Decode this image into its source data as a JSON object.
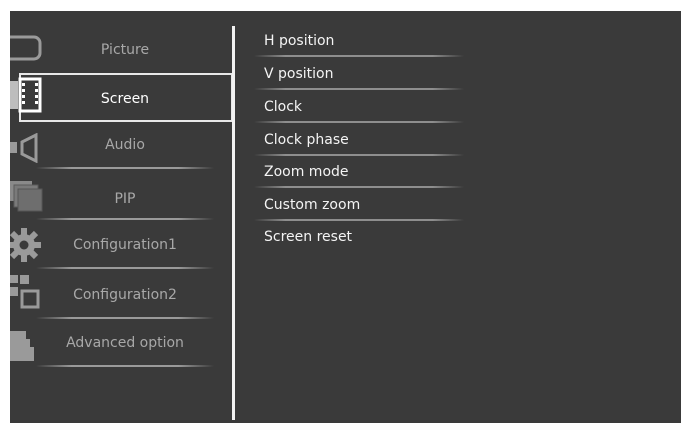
{
  "menu": {
    "items": [
      {
        "label": "Picture",
        "icon": "monitor-icon"
      },
      {
        "label": "Screen",
        "icon": "film-strip-icon"
      },
      {
        "label": "Audio",
        "icon": "speaker-icon"
      },
      {
        "label": "PIP",
        "icon": "stacked-screens-icon"
      },
      {
        "label": "Configuration1",
        "icon": "gear-icon"
      },
      {
        "label": "Configuration2",
        "icon": "grid-squares-icon"
      },
      {
        "label": "Advanced option",
        "icon": "staircase-icon"
      }
    ],
    "selected": "Screen"
  },
  "submenu": {
    "items": [
      {
        "label": "H position"
      },
      {
        "label": "V position"
      },
      {
        "label": "Clock"
      },
      {
        "label": "Clock phase"
      },
      {
        "label": "Zoom mode"
      },
      {
        "label": "Custom zoom"
      },
      {
        "label": "Screen reset"
      }
    ]
  },
  "colors": {
    "background": "#3a3a3a",
    "selected_text": "#ffffff",
    "unselected_text": "#a8a8a8",
    "accent_border": "#e8e8e8"
  }
}
